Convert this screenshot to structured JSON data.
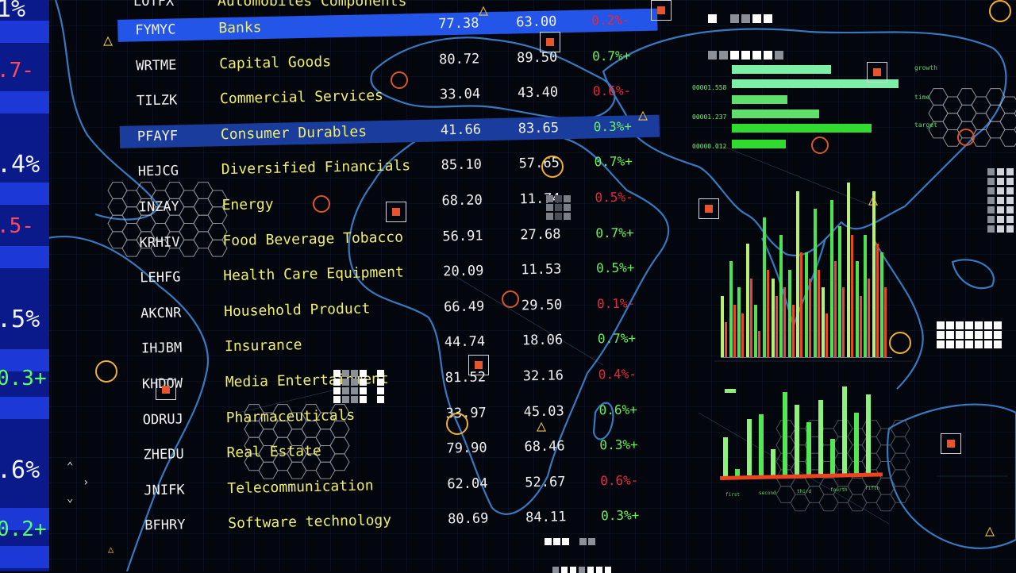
{
  "left_strip": [
    {
      "text": "1%",
      "tone": "w"
    },
    {
      "text": ".7-",
      "tone": "r"
    },
    {
      "text": ".4%",
      "tone": "w"
    },
    {
      "text": ".5-",
      "tone": "r"
    },
    {
      "text": ".5%",
      "tone": "w"
    },
    {
      "text": "0.3+",
      "tone": "g"
    },
    {
      "text": ".6%",
      "tone": "w"
    },
    {
      "text": "0.2+",
      "tone": "g"
    }
  ],
  "top_partial": {
    "ticker": "LOTFX",
    "category": "Automobiles Components"
  },
  "rows": [
    {
      "ticker": "FYMYC",
      "category": "Banks",
      "price": "77.38",
      "target": "63.00",
      "change": "0.2%-",
      "highlight": "bright"
    },
    {
      "ticker": "WRTME",
      "category": "Capital Goods",
      "price": "80.72",
      "target": "89.50",
      "change": "0.7%+",
      "highlight": ""
    },
    {
      "ticker": "TILZK",
      "category": "Commercial Services",
      "price": "33.04",
      "target": "43.40",
      "change": "0.6%-",
      "highlight": ""
    },
    {
      "ticker": "PFAYF",
      "category": "Consumer Durables",
      "price": "41.66",
      "target": "83.65",
      "change": "0.3%+",
      "highlight": "dim"
    },
    {
      "ticker": "HEJCG",
      "category": "Diversified Financials",
      "price": "85.10",
      "target": "57.65",
      "change": "0.7%+",
      "highlight": ""
    },
    {
      "ticker": "INZAY",
      "category": "Energy",
      "price": "68.20",
      "target": "11.74",
      "change": "0.5%-",
      "highlight": ""
    },
    {
      "ticker": "KRHIV",
      "category": "Food Beverage Tobacco",
      "price": "56.91",
      "target": "27.68",
      "change": "0.7%+",
      "highlight": ""
    },
    {
      "ticker": "LEHFG",
      "category": "Health Care Equipment",
      "price": "20.09",
      "target": "11.53",
      "change": "0.5%+",
      "highlight": ""
    },
    {
      "ticker": "AKCNR",
      "category": "Household Product",
      "price": "66.49",
      "target": "29.50",
      "change": "0.1%-",
      "highlight": ""
    },
    {
      "ticker": "IHJBM",
      "category": "Insurance",
      "price": "44.74",
      "target": "18.06",
      "change": "0.7%+",
      "highlight": ""
    },
    {
      "ticker": "KHDOW",
      "category": "Media Entertainment",
      "price": "81.52",
      "target": "32.16",
      "change": "0.4%-",
      "highlight": ""
    },
    {
      "ticker": "ODRUJ",
      "category": "Pharmaceuticals",
      "price": "33.97",
      "target": "45.03",
      "change": "0.6%+",
      "highlight": ""
    },
    {
      "ticker": "ZHEDU",
      "category": "Real Estate",
      "price": "79.90",
      "target": "68.46",
      "change": "0.3%+",
      "highlight": ""
    },
    {
      "ticker": "JNIFK",
      "category": "Telecommunication",
      "price": "62.04",
      "target": "52.67",
      "change": "0.6%-",
      "highlight": ""
    },
    {
      "ticker": "BFHRY",
      "category": "Software technology",
      "price": "80.69",
      "target": "84.11",
      "change": "0.3%+",
      "highlight": ""
    }
  ],
  "hbar_panel": {
    "labels": [
      "00001.558",
      "00001.237",
      "00000.012"
    ],
    "side_labels": [
      "growth",
      "time",
      "target"
    ],
    "colors": {
      "light": "#7df0a8",
      "mid": "#5ee06a",
      "bright": "#2edb2e"
    }
  },
  "bar_chart_top": {
    "green": [
      35,
      55,
      40,
      65,
      30,
      80,
      45,
      70,
      50,
      95,
      60,
      85,
      40,
      90,
      75,
      100,
      55,
      70,
      95,
      60
    ],
    "red": [
      20,
      30,
      25,
      45,
      15,
      50,
      35,
      40,
      30,
      60,
      45,
      50,
      25,
      55,
      40,
      70,
      35,
      45,
      65,
      40
    ]
  },
  "bar_chart_bottom": {
    "labels": [
      "first",
      "second",
      "third",
      "fourth",
      "fifth"
    ],
    "green": [
      45,
      8,
      65,
      70,
      30,
      95,
      80,
      60,
      85,
      40,
      100,
      70,
      90
    ],
    "baseline_color": "#f0421e"
  },
  "colors": {
    "accent": "#2255e8",
    "positive": "#6cf05a",
    "negative": "#e8283c",
    "category": "#f1ee6a",
    "map_line": "#3f8ee0"
  }
}
